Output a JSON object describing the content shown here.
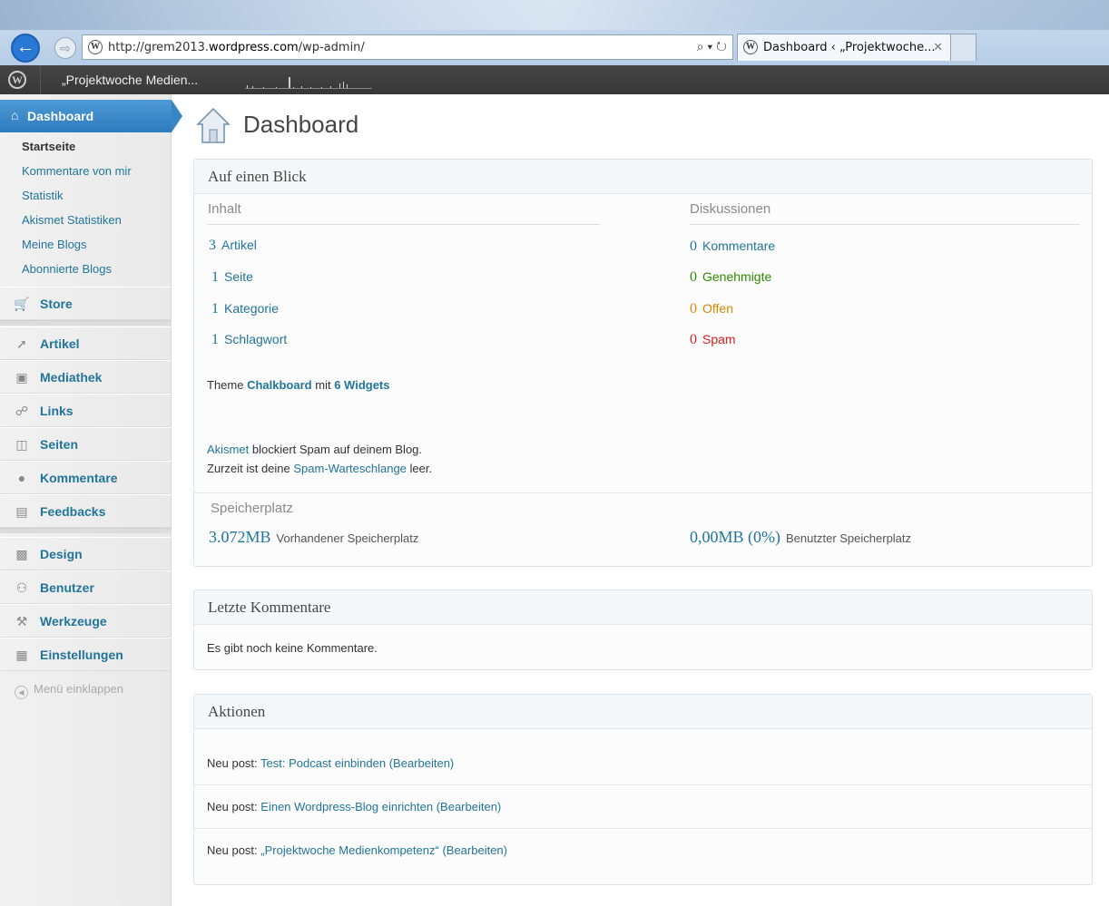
{
  "browser": {
    "url_prefix": "http://grem2013.",
    "url_domain": "wordpress.com",
    "url_suffix": "/wp-admin/",
    "search_glyph": "⌕ ▾ ↻",
    "tab_title": "Dashboard ‹ „Projektwoche...",
    "tab_close": "✕"
  },
  "adminbar": {
    "site_name": "„Projektwoche Medien..."
  },
  "sidebar": {
    "dashboard_label": "Dashboard",
    "submenu": [
      {
        "label": "Startseite"
      },
      {
        "label": "Kommentare von mir"
      },
      {
        "label": "Statistik"
      },
      {
        "label": "Akismet Statistiken"
      },
      {
        "label": "Meine Blogs"
      },
      {
        "label": "Abonnierte Blogs"
      }
    ],
    "store": "Store",
    "group1": [
      "Artikel",
      "Mediathek",
      "Links",
      "Seiten",
      "Kommentare",
      "Feedbacks"
    ],
    "group2": [
      "Design",
      "Benutzer",
      "Werkzeuge",
      "Einstellungen"
    ],
    "collapse": "Menü einklappen"
  },
  "main": {
    "page_title": "Dashboard",
    "glance": {
      "title": "Auf einen Blick",
      "col_content": "Inhalt",
      "col_discussion": "Diskussionen",
      "content": [
        {
          "num": "3",
          "label": "Artikel"
        },
        {
          "num": "1",
          "label": "Seite"
        },
        {
          "num": "1",
          "label": "Kategorie"
        },
        {
          "num": "1",
          "label": "Schlagwort"
        }
      ],
      "discussion": [
        {
          "num": "0",
          "label": "Kommentare"
        },
        {
          "num": "0",
          "label": "Genehmigte"
        },
        {
          "num": "0",
          "label": "Offen"
        },
        {
          "num": "0",
          "label": "Spam"
        }
      ],
      "theme_prefix": "Theme",
      "theme_name": "Chalkboard",
      "theme_mid": "mit",
      "widgets": "6 Widgets",
      "akismet_link": "Akismet",
      "akismet_text": "blockiert Spam auf deinem Blog.",
      "queue_prefix": "Zurzeit ist deine",
      "queue_link": "Spam-Warteschlange",
      "queue_suffix": "leer.",
      "storage_title": "Speicherplatz",
      "storage_available_value": "3.072MB",
      "storage_available_label": "Vorhandener Speicherplatz",
      "storage_used_value": "0,00MB (0%)",
      "storage_used_label": "Benutzter Speicherplatz"
    },
    "comments": {
      "title": "Letzte Kommentare",
      "empty": "Es gibt noch keine Kommentare."
    },
    "actions": {
      "title": "Aktionen",
      "prefix": "Neu post:",
      "edit": "(Bearbeiten)",
      "items": [
        {
          "title": "Test: Podcast einbinden"
        },
        {
          "title": "Einen Wordpress-Blog einrichten"
        },
        {
          "title": "„Projektwoche Medienkompetenz“"
        }
      ]
    }
  }
}
